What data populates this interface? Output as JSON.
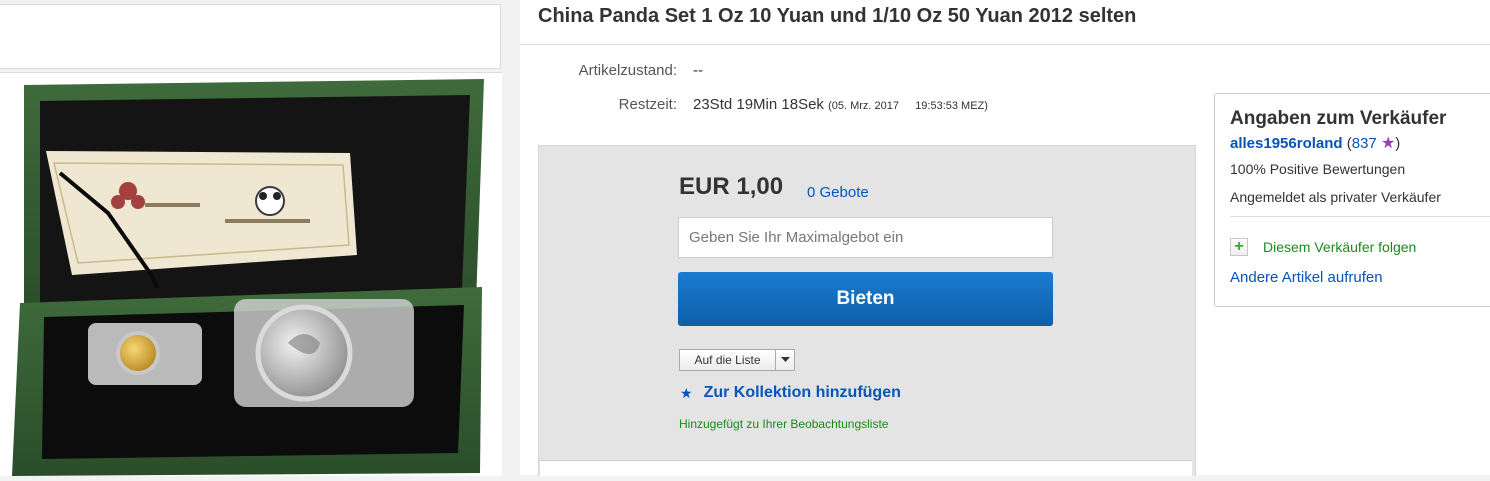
{
  "listing": {
    "title": "China Panda Set 1 Oz 10 Yuan und 1/10 Oz 50 Yuan 2012 selten"
  },
  "details": {
    "condition_label": "Artikelzustand:",
    "condition_value": "--",
    "time_label": "Restzeit:",
    "time_value": "23Std 19Min 18Sek",
    "end_date": "(05. Mrz. 2017",
    "end_time": "19:53:53 MEZ)"
  },
  "bidding": {
    "price": "EUR 1,00",
    "bid_count": "0 Gebote",
    "input_placeholder": "Geben Sie Ihr Maximalgebot ein",
    "bid_button": "Bieten",
    "watchlist_button": "Auf die Liste",
    "collection_link": "Zur Kollektion hinzufügen",
    "watch_note": "Hinzugefügt zu Ihrer Beobachtungsliste"
  },
  "seller": {
    "heading": "Angaben zum Verkäufer",
    "name": "alles1956roland",
    "open_paren": "(",
    "score": "837",
    "close_paren": ")",
    "positive": "100% Positive Bewertungen",
    "registered": "Angemeldet als privater Verkäufer",
    "follow": "Diesem Verkäufer folgen",
    "other_items": "Andere Artikel aufrufen"
  },
  "colors": {
    "link_blue": "#0654ba",
    "bid_button": "#0c5fa9",
    "success_green": "#1a8a1a",
    "star_purple": "#9b3fb5"
  },
  "icons": {
    "collection": "star-icon",
    "rating": "rating-star-icon",
    "follow": "plus-icon",
    "watch_dropdown": "caret-down-icon"
  }
}
